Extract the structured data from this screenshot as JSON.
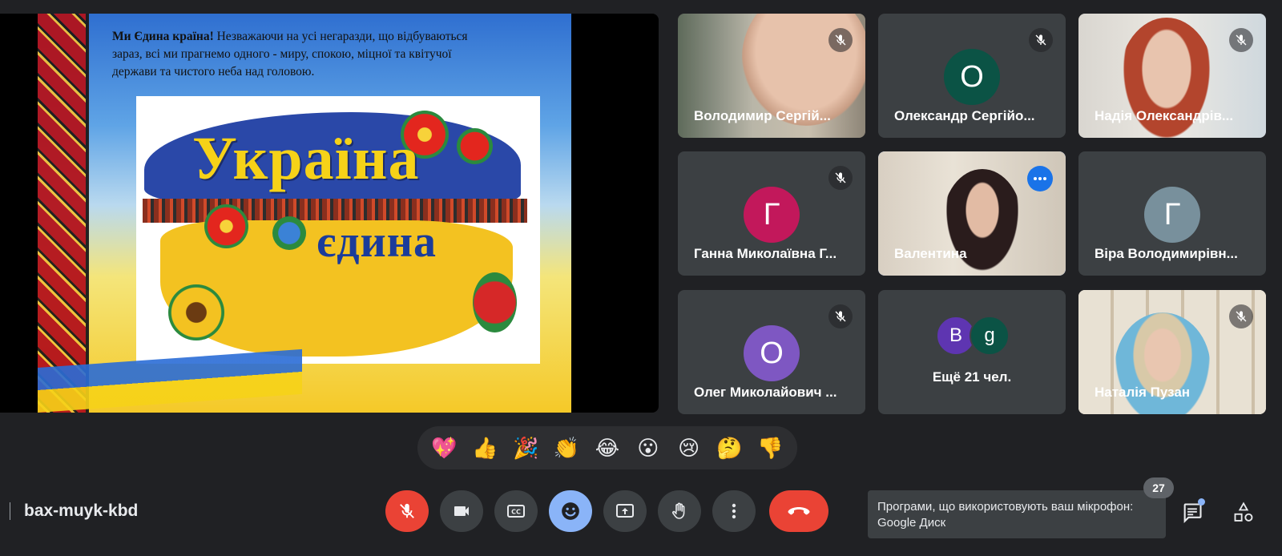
{
  "presentation": {
    "caption_bold": "Ми Єдина країна!",
    "caption_text": " Незважаючи на усі негаразди, що відбуваються зараз, всі ми прагнемо одного - миру, спокою, міцної та квітучої держави та чистого неба над головою.",
    "title_word1": "Україна",
    "title_word2": "єдина"
  },
  "participants": [
    {
      "name": "Володимир Сергій...",
      "type": "video",
      "muted": true
    },
    {
      "name": "Олександр Сергійо...",
      "type": "avatar",
      "initial": "О",
      "color": "#0b5345",
      "muted": true
    },
    {
      "name": "Надія Олександрів...",
      "type": "video",
      "muted": true
    },
    {
      "name": "Ганна Миколаївна Г...",
      "type": "avatar",
      "initial": "Г",
      "color": "#c2185b",
      "muted": true
    },
    {
      "name": "Валентина",
      "type": "video",
      "muted": false,
      "active": true
    },
    {
      "name": "Віра Володимирівн...",
      "type": "avatar",
      "initial": "Г",
      "color": "#78909c",
      "muted": false
    },
    {
      "name": "Олег Миколайович ...",
      "type": "avatar",
      "initial": "О",
      "color": "#7e57c2",
      "muted": true
    },
    {
      "name": "Ещё 21 чел.",
      "type": "more",
      "avatars": [
        {
          "initial": "B",
          "color": "#5e35b1"
        },
        {
          "initial": "g",
          "color": "#0b5345"
        }
      ]
    },
    {
      "name": "Наталія Пузан",
      "type": "video",
      "muted": true
    }
  ],
  "reactions": [
    "💖",
    "👍",
    "🎉",
    "👏",
    "😂",
    "😮",
    "😢",
    "🤔",
    "👎"
  ],
  "bottom_bar": {
    "meeting_code": "bax-muyk-kbd",
    "participant_count": "27",
    "tooltip_line1": "Програми, що використовують ваш мікрофон:",
    "tooltip_line2": "Google Диск"
  },
  "colors": {
    "background": "#202124",
    "tile": "#3c4043",
    "red": "#ea4335",
    "accent_blue": "#8ab4f8"
  }
}
